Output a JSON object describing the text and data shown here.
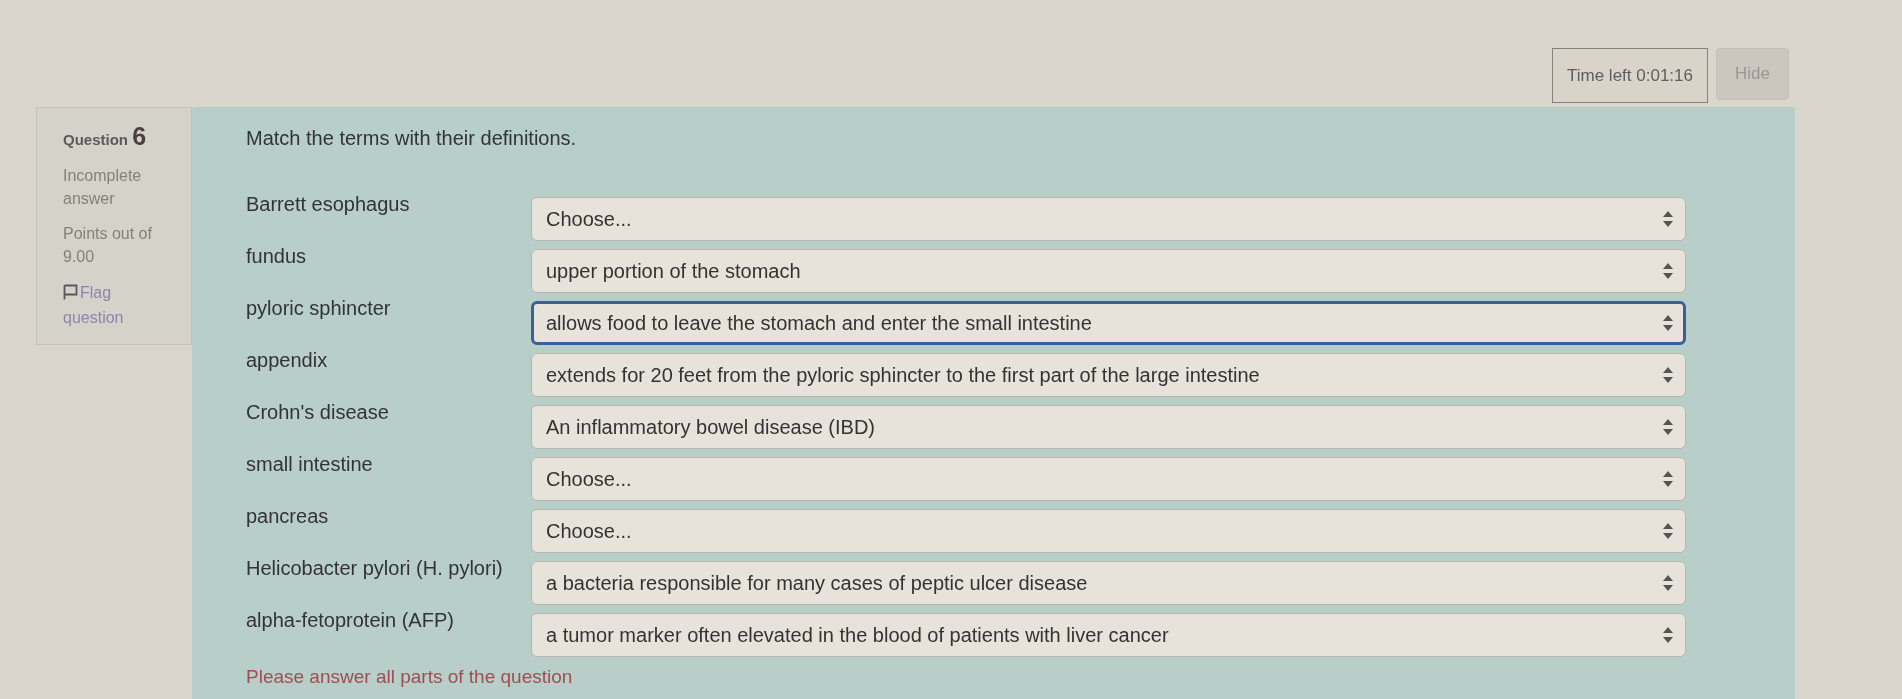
{
  "timer": {
    "label": "Time left",
    "value": "0:01:16"
  },
  "hide_button": {
    "label": "Hide"
  },
  "question_info": {
    "label": "Question",
    "number": "6",
    "state": "Incomplete answer",
    "grade": "Points out of 9.00",
    "flag_link": "Flag question"
  },
  "question": {
    "prompt": "Match the terms with their definitions.",
    "rows": [
      {
        "term": "Barrett esophagus",
        "answer": "Choose...",
        "focused": false
      },
      {
        "term": "fundus",
        "answer": "upper portion of the stomach",
        "focused": false
      },
      {
        "term": "pyloric sphincter",
        "answer": "allows food to leave the stomach and enter the small intestine",
        "focused": true
      },
      {
        "term": "appendix",
        "answer": "extends for 20 feet from the pyloric sphincter to the first part of the large intestine",
        "focused": false
      },
      {
        "term": "Crohn's disease",
        "answer": "An inflammatory bowel disease (IBD)",
        "focused": false
      },
      {
        "term": "small intestine",
        "answer": "Choose...",
        "focused": false
      },
      {
        "term": "pancreas",
        "answer": "Choose...",
        "focused": false
      },
      {
        "term": "Helicobacter pylori (H. pylori)",
        "answer": "a bacteria responsible for many cases of peptic ulcer disease",
        "focused": false
      },
      {
        "term": "alpha-fetoprotein (AFP)",
        "answer": "a tumor marker often elevated in the blood of patients with liver cancer",
        "focused": false
      }
    ],
    "validation_error": "Please answer all parts of the question"
  }
}
